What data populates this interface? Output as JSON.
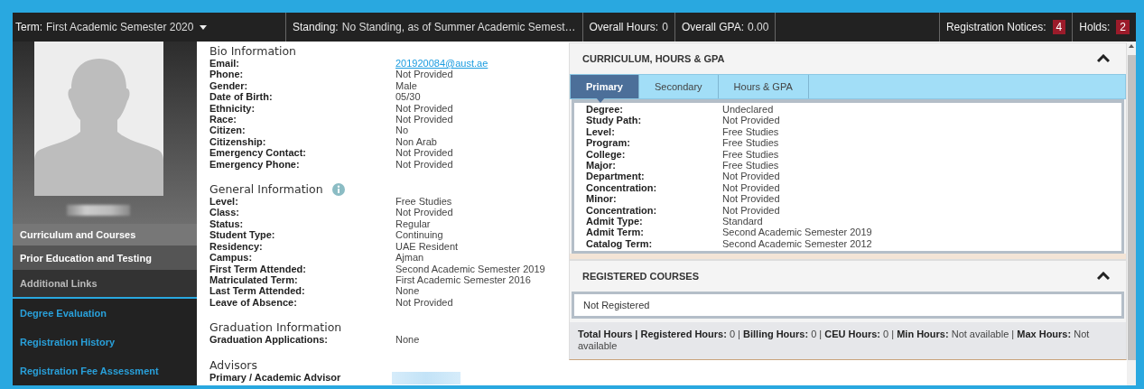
{
  "top_bar": {
    "term": {
      "label": "Term:",
      "value": "First Academic Semester 2020"
    },
    "stats": [
      {
        "label": "Standing:",
        "value": "No Standing, as of Summer Academic Semest…"
      },
      {
        "label": "Overall Hours:",
        "value": "0"
      },
      {
        "label": "Overall GPA:",
        "value": "0.00"
      }
    ],
    "notices": [
      {
        "label": "Registration Notices:",
        "count": "4"
      },
      {
        "label": "Holds:",
        "count": "2"
      }
    ]
  },
  "sidebar": {
    "photo": {
      "kind": "placeholder"
    },
    "sections": [
      {
        "label": "Curriculum and Courses",
        "selected": true
      },
      {
        "label": "Prior Education and Testing",
        "selected": false
      }
    ],
    "links_heading": "Additional Links",
    "links": [
      "Degree Evaluation",
      "Registration History",
      "Registration Fee Assessment"
    ]
  },
  "profile": [
    {
      "title": "Bio Information",
      "info": false,
      "rows": [
        {
          "label": "Email:",
          "value": "201920084@aust.ae",
          "kind": "link"
        },
        {
          "label": "Phone:",
          "value": "Not Provided"
        },
        {
          "label": "Gender:",
          "value": "Male"
        },
        {
          "label": "Date of Birth:",
          "value": "05/30"
        },
        {
          "label": "Ethnicity:",
          "value": "Not Provided"
        },
        {
          "label": "Race:",
          "value": "Not Provided"
        },
        {
          "label": "Citizen:",
          "value": "No"
        },
        {
          "label": "Citizenship:",
          "value": "Non Arab"
        },
        {
          "label": "Emergency Contact:",
          "value": "Not Provided"
        },
        {
          "label": "Emergency Phone:",
          "value": "Not Provided"
        }
      ]
    },
    {
      "title": "General Information",
      "info": true,
      "rows": [
        {
          "label": "Level:",
          "value": "Free Studies"
        },
        {
          "label": "Class:",
          "value": "Not Provided"
        },
        {
          "label": "Status:",
          "value": "Regular"
        },
        {
          "label": "Student Type:",
          "value": "Continuing"
        },
        {
          "label": "Residency:",
          "value": "UAE Resident"
        },
        {
          "label": "Campus:",
          "value": "Ajman"
        },
        {
          "label": "First Term Attended:",
          "value": "Second Academic Semester 2019"
        },
        {
          "label": "Matriculated Term:",
          "value": "First Academic Semester 2016"
        },
        {
          "label": "Last Term Attended:",
          "value": "None"
        },
        {
          "label": "Leave of Absence:",
          "value": "Not Provided"
        }
      ]
    },
    {
      "title": "Graduation Information",
      "info": false,
      "rows": [
        {
          "label": "Graduation Applications:",
          "value": "None"
        }
      ]
    },
    {
      "title": "Advisors",
      "info": false,
      "rows": [
        {
          "label": "Primary / Academic Advisor",
          "kind": "hidden"
        }
      ]
    }
  ],
  "curriculum": {
    "title": "CURRICULUM, HOURS & GPA",
    "expanded": true,
    "tabs": [
      {
        "label": "Primary",
        "selected": true
      },
      {
        "label": "Secondary",
        "selected": false
      },
      {
        "label": "Hours & GPA",
        "selected": false
      }
    ],
    "rows": [
      {
        "label": "Degree:",
        "value": "Undeclared"
      },
      {
        "label": "Study Path:",
        "value": "Not Provided"
      },
      {
        "label": "Level:",
        "value": "Free Studies"
      },
      {
        "label": "Program:",
        "value": "Free Studies"
      },
      {
        "label": "College:",
        "value": "Free Studies"
      },
      {
        "label": "Major:",
        "value": "Free Studies"
      },
      {
        "label": "Department:",
        "value": "Not Provided"
      },
      {
        "label": "Concentration:",
        "value": "Not Provided"
      },
      {
        "label": "Minor:",
        "value": "Not Provided"
      },
      {
        "label": "Concentration:",
        "value": "Not Provided"
      },
      {
        "label": "Admit Type:",
        "value": "Standard"
      },
      {
        "label": "Admit Term:",
        "value": "Second Academic Semester 2019"
      },
      {
        "label": "Catalog Term:",
        "value": "Second Academic Semester 2012"
      }
    ]
  },
  "registered": {
    "title": "REGISTERED COURSES",
    "expanded": true,
    "message": "Not Registered",
    "summary": "**Total Hours |**  **Registered Hours:**  0  |  **Billing Hours:**  0  |  **CEU Hours:**  0  | **Min Hours:**  Not available  |  **Max Hours:** Not available"
  }
}
